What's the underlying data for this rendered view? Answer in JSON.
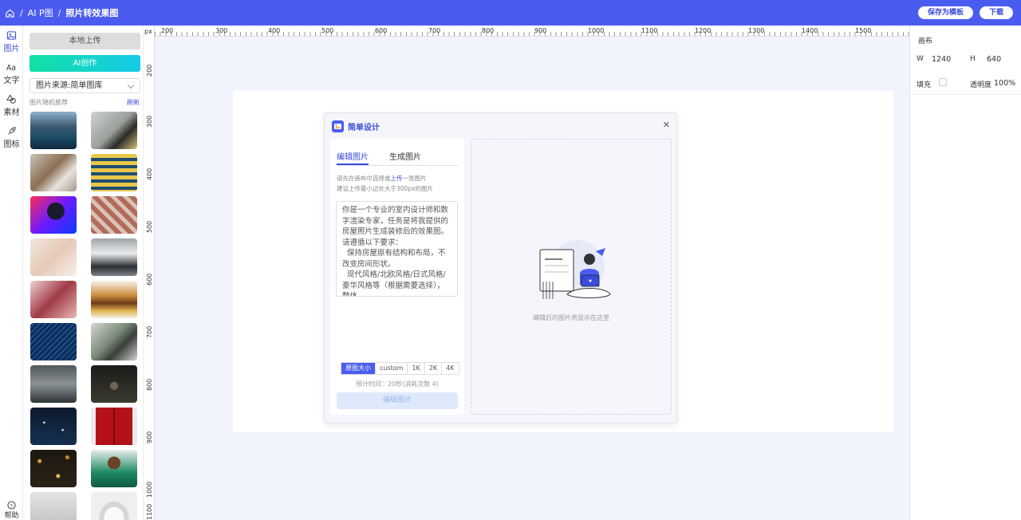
{
  "header": {
    "breadcrumb": [
      "AI P图",
      "照片转效果图"
    ],
    "save_template": "保存为模板",
    "download": "下载"
  },
  "rail": {
    "items": [
      {
        "label": "图片",
        "icon": "image-icon",
        "active": true
      },
      {
        "label": "文字",
        "icon": "text-icon",
        "active": false
      },
      {
        "label": "素材",
        "icon": "shapes-icon",
        "active": false
      },
      {
        "label": "图标",
        "icon": "rocket-icon",
        "active": false
      }
    ],
    "help": "帮助"
  },
  "left_panel": {
    "upload": "本地上传",
    "ai_create": "AI创作",
    "source_select": "图片来源:简单图库",
    "recommend_label": "图片随机推荐",
    "refresh": "刷新"
  },
  "rulers": {
    "unit": "px",
    "h_labels": [
      "200",
      "300",
      "400",
      "500",
      "600",
      "700",
      "800",
      "900",
      "1000",
      "1100",
      "1200",
      "1300",
      "1400",
      "1500"
    ],
    "v_labels": [
      "200",
      "300",
      "400",
      "500",
      "600",
      "700",
      "800",
      "900",
      "1000",
      "1100"
    ]
  },
  "dialog": {
    "title": "简单设计",
    "tabs": [
      "编辑图片",
      "生成图片"
    ],
    "hint_line1_a": "请先在画布中选择或",
    "hint_line1_link": "上传",
    "hint_line1_b": "一张图片",
    "hint_line2": "建议上传最小边长大于300px的图片",
    "prompt": "你是一个专业的室内设计师和数字渲染专家，任务是将我提供的房屋照片生成装修后的效果图。请遵循以下要求：\n  保持房屋原有结构和布局，不改变房间形状。\n  现代风格/北欧风格/日式风格/豪华风格等（根据需要选择），整体",
    "sizes": [
      "原图大小",
      "custom",
      "1K",
      "2K",
      "4K"
    ],
    "eta": "预计时间：20秒(消耗次数 4)",
    "edit_button": "编辑图片",
    "placeholder": "编辑后的图片将显示在这里"
  },
  "right_panel": {
    "title": "画布",
    "w_label": "W",
    "w_value": "1240",
    "h_label": "H",
    "h_value": "640",
    "fill_label": "填充",
    "opacity_label": "透明度",
    "opacity_value": "100%"
  }
}
